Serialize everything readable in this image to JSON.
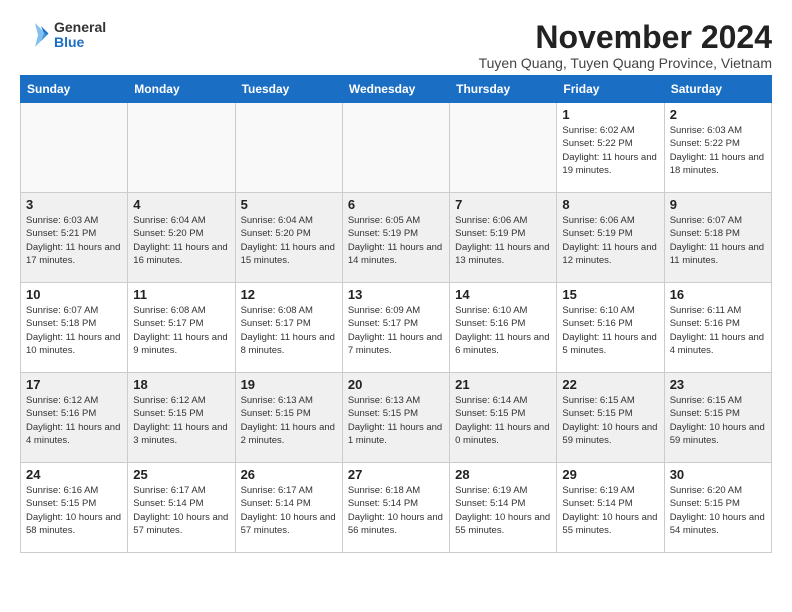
{
  "header": {
    "logo_general": "General",
    "logo_blue": "Blue",
    "month_title": "November 2024",
    "subtitle": "Tuyen Quang, Tuyen Quang Province, Vietnam"
  },
  "days_of_week": [
    "Sunday",
    "Monday",
    "Tuesday",
    "Wednesday",
    "Thursday",
    "Friday",
    "Saturday"
  ],
  "weeks": [
    [
      {
        "day": "",
        "info": ""
      },
      {
        "day": "",
        "info": ""
      },
      {
        "day": "",
        "info": ""
      },
      {
        "day": "",
        "info": ""
      },
      {
        "day": "",
        "info": ""
      },
      {
        "day": "1",
        "info": "Sunrise: 6:02 AM\nSunset: 5:22 PM\nDaylight: 11 hours and 19 minutes."
      },
      {
        "day": "2",
        "info": "Sunrise: 6:03 AM\nSunset: 5:22 PM\nDaylight: 11 hours and 18 minutes."
      }
    ],
    [
      {
        "day": "3",
        "info": "Sunrise: 6:03 AM\nSunset: 5:21 PM\nDaylight: 11 hours and 17 minutes."
      },
      {
        "day": "4",
        "info": "Sunrise: 6:04 AM\nSunset: 5:20 PM\nDaylight: 11 hours and 16 minutes."
      },
      {
        "day": "5",
        "info": "Sunrise: 6:04 AM\nSunset: 5:20 PM\nDaylight: 11 hours and 15 minutes."
      },
      {
        "day": "6",
        "info": "Sunrise: 6:05 AM\nSunset: 5:19 PM\nDaylight: 11 hours and 14 minutes."
      },
      {
        "day": "7",
        "info": "Sunrise: 6:06 AM\nSunset: 5:19 PM\nDaylight: 11 hours and 13 minutes."
      },
      {
        "day": "8",
        "info": "Sunrise: 6:06 AM\nSunset: 5:19 PM\nDaylight: 11 hours and 12 minutes."
      },
      {
        "day": "9",
        "info": "Sunrise: 6:07 AM\nSunset: 5:18 PM\nDaylight: 11 hours and 11 minutes."
      }
    ],
    [
      {
        "day": "10",
        "info": "Sunrise: 6:07 AM\nSunset: 5:18 PM\nDaylight: 11 hours and 10 minutes."
      },
      {
        "day": "11",
        "info": "Sunrise: 6:08 AM\nSunset: 5:17 PM\nDaylight: 11 hours and 9 minutes."
      },
      {
        "day": "12",
        "info": "Sunrise: 6:08 AM\nSunset: 5:17 PM\nDaylight: 11 hours and 8 minutes."
      },
      {
        "day": "13",
        "info": "Sunrise: 6:09 AM\nSunset: 5:17 PM\nDaylight: 11 hours and 7 minutes."
      },
      {
        "day": "14",
        "info": "Sunrise: 6:10 AM\nSunset: 5:16 PM\nDaylight: 11 hours and 6 minutes."
      },
      {
        "day": "15",
        "info": "Sunrise: 6:10 AM\nSunset: 5:16 PM\nDaylight: 11 hours and 5 minutes."
      },
      {
        "day": "16",
        "info": "Sunrise: 6:11 AM\nSunset: 5:16 PM\nDaylight: 11 hours and 4 minutes."
      }
    ],
    [
      {
        "day": "17",
        "info": "Sunrise: 6:12 AM\nSunset: 5:16 PM\nDaylight: 11 hours and 4 minutes."
      },
      {
        "day": "18",
        "info": "Sunrise: 6:12 AM\nSunset: 5:15 PM\nDaylight: 11 hours and 3 minutes."
      },
      {
        "day": "19",
        "info": "Sunrise: 6:13 AM\nSunset: 5:15 PM\nDaylight: 11 hours and 2 minutes."
      },
      {
        "day": "20",
        "info": "Sunrise: 6:13 AM\nSunset: 5:15 PM\nDaylight: 11 hours and 1 minute."
      },
      {
        "day": "21",
        "info": "Sunrise: 6:14 AM\nSunset: 5:15 PM\nDaylight: 11 hours and 0 minutes."
      },
      {
        "day": "22",
        "info": "Sunrise: 6:15 AM\nSunset: 5:15 PM\nDaylight: 10 hours and 59 minutes."
      },
      {
        "day": "23",
        "info": "Sunrise: 6:15 AM\nSunset: 5:15 PM\nDaylight: 10 hours and 59 minutes."
      }
    ],
    [
      {
        "day": "24",
        "info": "Sunrise: 6:16 AM\nSunset: 5:15 PM\nDaylight: 10 hours and 58 minutes."
      },
      {
        "day": "25",
        "info": "Sunrise: 6:17 AM\nSunset: 5:14 PM\nDaylight: 10 hours and 57 minutes."
      },
      {
        "day": "26",
        "info": "Sunrise: 6:17 AM\nSunset: 5:14 PM\nDaylight: 10 hours and 57 minutes."
      },
      {
        "day": "27",
        "info": "Sunrise: 6:18 AM\nSunset: 5:14 PM\nDaylight: 10 hours and 56 minutes."
      },
      {
        "day": "28",
        "info": "Sunrise: 6:19 AM\nSunset: 5:14 PM\nDaylight: 10 hours and 55 minutes."
      },
      {
        "day": "29",
        "info": "Sunrise: 6:19 AM\nSunset: 5:14 PM\nDaylight: 10 hours and 55 minutes."
      },
      {
        "day": "30",
        "info": "Sunrise: 6:20 AM\nSunset: 5:15 PM\nDaylight: 10 hours and 54 minutes."
      }
    ]
  ]
}
